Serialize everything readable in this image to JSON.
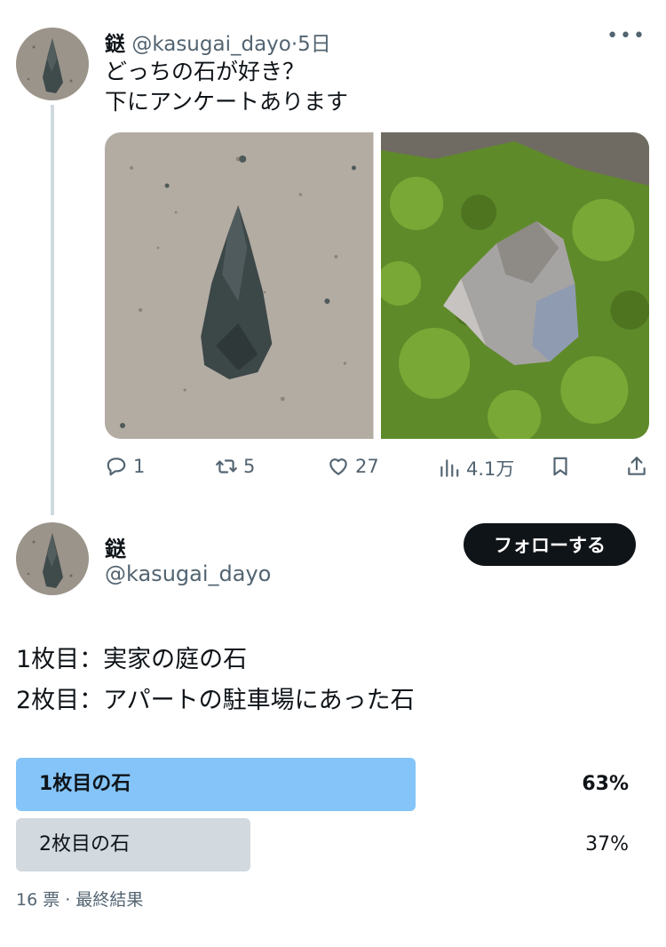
{
  "tweet": {
    "author_name": "鎹",
    "author_handle": "@kasugai_dayo",
    "separator": "·",
    "time": "5日",
    "more": "•••",
    "text_line1": "どっちの石が好き？",
    "text_line2": "下にアンケートあります",
    "actions": {
      "replies": "1",
      "retweets": "5",
      "likes": "27",
      "views": "4.1万"
    }
  },
  "reply": {
    "author_name": "鎹",
    "author_handle": "@kasugai_dayo",
    "follow_label": "フォローする",
    "text_line1": "1枚目：実家の庭の石",
    "text_line2": "2枚目：アパートの駐車場にあった石"
  },
  "poll": {
    "options": [
      {
        "label": "1枚目の石",
        "percent_text": "63%",
        "fraction": 0.63,
        "winner": true
      },
      {
        "label": "2枚目の石",
        "percent_text": "37%",
        "fraction": 0.37,
        "winner": false
      }
    ],
    "votes": "16 票",
    "separator": "·",
    "status": "最終結果"
  },
  "colors": {
    "winner_bar": "#84c4f8",
    "loser_bar": "#d2d9df",
    "muted_text": "#536471",
    "thread_line": "#cfd9de"
  },
  "icons": [
    "reply-icon",
    "retweet-icon",
    "like-icon",
    "views-icon",
    "bookmark-icon",
    "share-icon"
  ]
}
